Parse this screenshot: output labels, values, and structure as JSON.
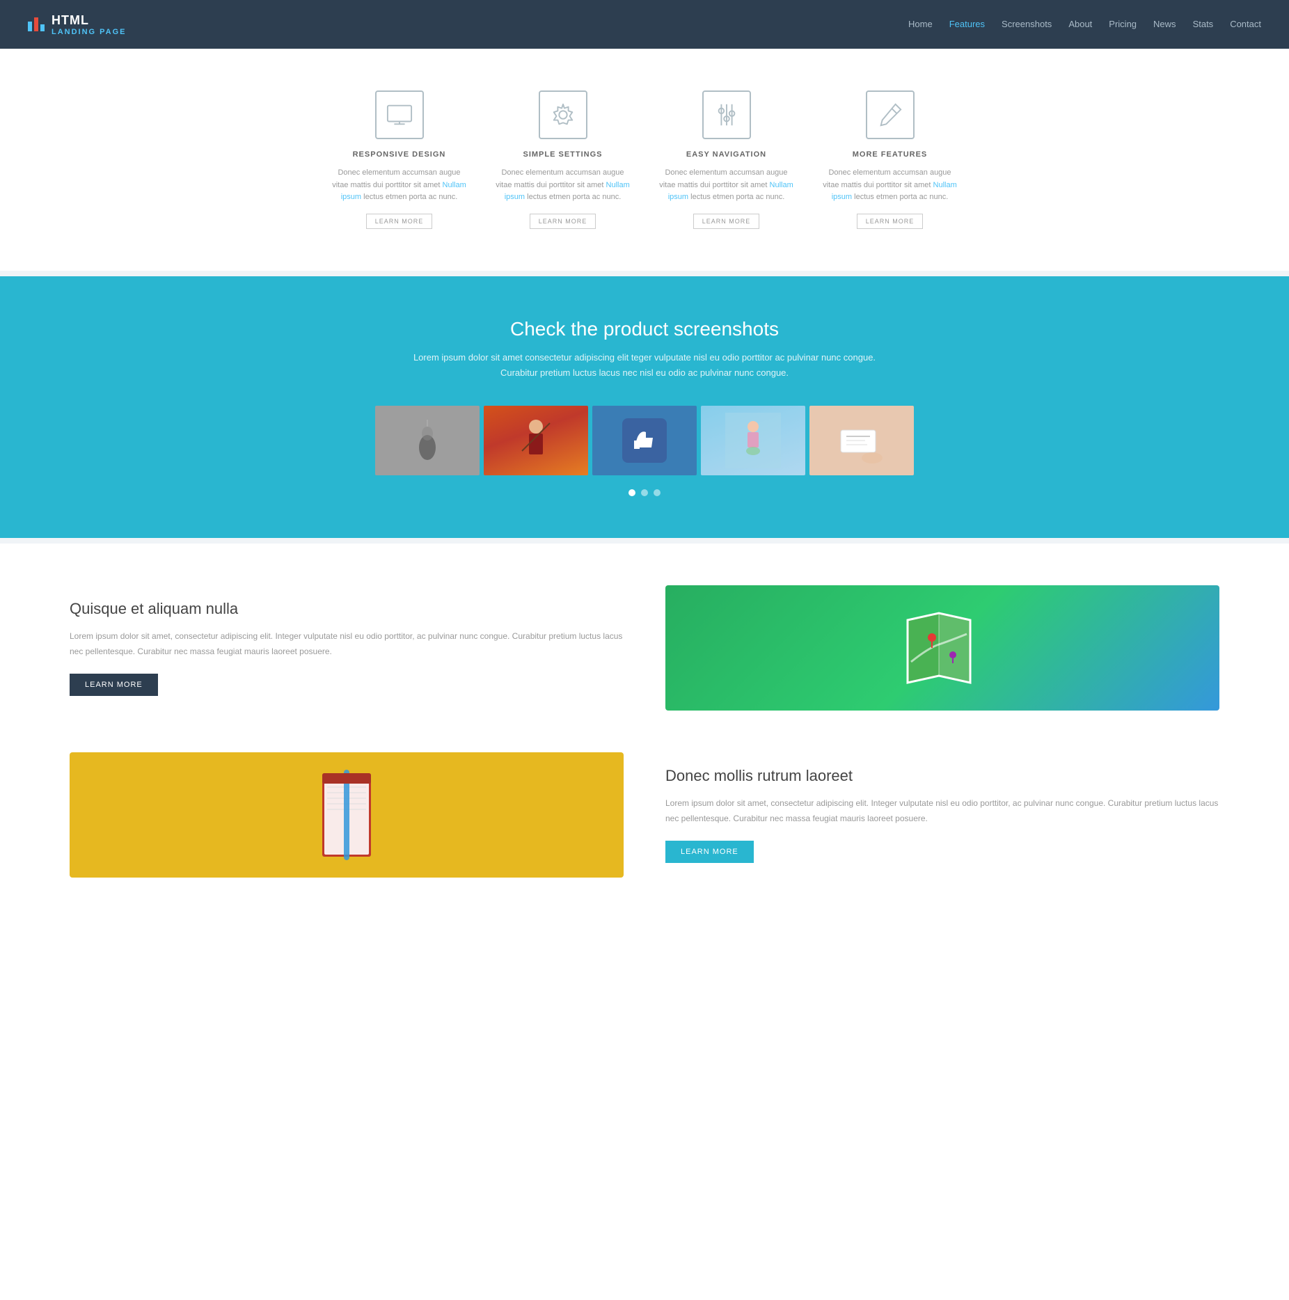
{
  "brand": {
    "html_label": "HTML",
    "sub_label": "LANDING PAGE"
  },
  "nav": {
    "items": [
      {
        "label": "Home",
        "href": "#",
        "active": false
      },
      {
        "label": "Features",
        "href": "#",
        "active": true
      },
      {
        "label": "Screenshots",
        "href": "#",
        "active": false
      },
      {
        "label": "About",
        "href": "#",
        "active": false
      },
      {
        "label": "Pricing",
        "href": "#",
        "active": false
      },
      {
        "label": "News",
        "href": "#",
        "active": false
      },
      {
        "label": "Stats",
        "href": "#",
        "active": false
      },
      {
        "label": "Contact",
        "href": "#",
        "active": false
      }
    ]
  },
  "features": {
    "items": [
      {
        "icon": "monitor",
        "title": "RESPONSIVE DESIGN",
        "text": "Donec elementum accumsan augue vitae mattis dui porttitor sit amet Nullam ipsum lectus etmen porta ac nunc.",
        "btn_label": "LEARN MORE"
      },
      {
        "icon": "gear",
        "title": "SIMPLE SETTINGS",
        "text": "Donec elementum accumsan augue vitae mattis dui porttitor sit amet Nullam ipsum lectus etmen porta ac nunc.",
        "btn_label": "LEARN MORE"
      },
      {
        "icon": "sliders",
        "title": "EASY NAVIGATION",
        "text": "Donec elementum accumsan augue vitae mattis dui porttitor sit amet Nullam ipsum lectus etmen porta ac nunc.",
        "btn_label": "LEARN MORE"
      },
      {
        "icon": "pencil",
        "title": "MORE FEATURES",
        "text": "Donec elementum accumsan augue vitae mattis dui porttitor sit amet Nullam ipsum lectus etmen porta ac nunc.",
        "btn_label": "LEARN MORE"
      }
    ]
  },
  "screenshots": {
    "title": "Check the product screenshots",
    "desc_line1": "Lorem ipsum dolor sit amet consectetur adipiscing elit teger vulputate nisl eu odio porttitor ac pulvinar nunc congue.",
    "desc_line2": "Curabitur pretium luctus lacus nec nisl eu odio ac pulvinar nunc congue.",
    "dots": [
      {
        "active": true
      },
      {
        "active": false
      },
      {
        "active": false
      }
    ]
  },
  "section1": {
    "title": "Quisque et aliquam nulla",
    "desc": "Lorem ipsum dolor sit amet, consectetur adipiscing elit. Integer vulputate nisl eu odio porttitor, ac pulvinar nunc congue. Curabitur pretium luctus lacus nec pellentesque. Curabitur nec massa feugiat mauris laoreet posuere.",
    "btn_label": "LEARN MORE"
  },
  "section2": {
    "title": "Donec mollis rutrum laoreet",
    "desc": "Lorem ipsum dolor sit amet, consectetur adipiscing elit. Integer vulputate nisl eu odio porttitor, ac pulvinar nunc congue. Curabitur pretium luctus lacus nec pellentesque. Curabitur nec massa feugiat mauris laoreet posuere.",
    "btn_label": "LEARN MORE"
  }
}
